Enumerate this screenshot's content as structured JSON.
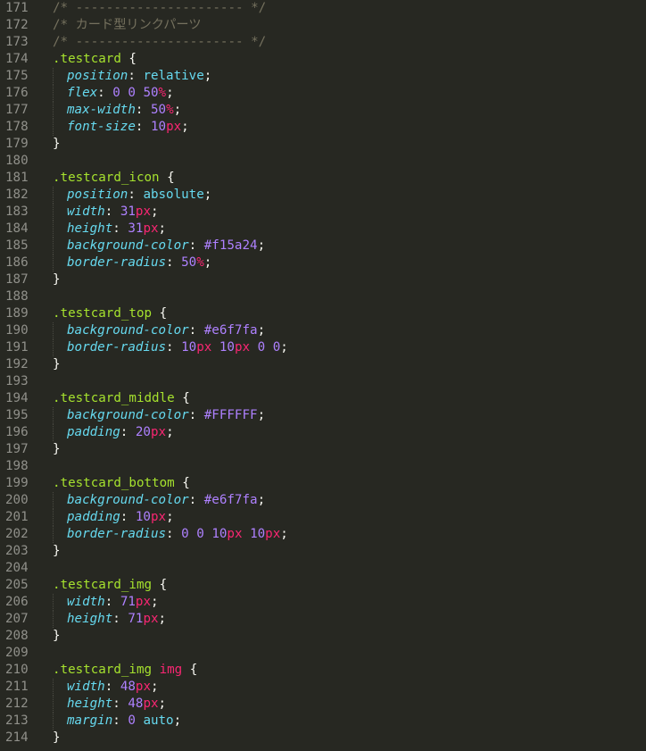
{
  "colors": {
    "background": "#272822",
    "line_number": "#90908a",
    "comment": "#75715e",
    "selector": "#a6e22e",
    "tag": "#f92672",
    "property": "#66d9ef",
    "value_keyword": "#66d9ef",
    "number": "#ae81ff",
    "unit": "#f92672",
    "punctuation": "#f8f8f2"
  },
  "lines": [
    {
      "n": "171",
      "tokens": [
        [
          "comment",
          "/* ---------------------- */"
        ]
      ]
    },
    {
      "n": "172",
      "tokens": [
        [
          "comment",
          "/* カード型リンクパーツ"
        ]
      ]
    },
    {
      "n": "173",
      "tokens": [
        [
          "comment",
          "/* ---------------------- */"
        ]
      ]
    },
    {
      "n": "174",
      "tokens": [
        [
          "sel",
          ".testcard"
        ],
        [
          "punct",
          " {"
        ]
      ]
    },
    {
      "n": "175",
      "indent": true,
      "tokens": [
        [
          "prop",
          "position"
        ],
        [
          "punct",
          ": "
        ],
        [
          "val",
          "relative"
        ],
        [
          "punct",
          ";"
        ]
      ]
    },
    {
      "n": "176",
      "indent": true,
      "tokens": [
        [
          "prop",
          "flex"
        ],
        [
          "punct",
          ": "
        ],
        [
          "num",
          "0"
        ],
        [
          "punct",
          " "
        ],
        [
          "num",
          "0"
        ],
        [
          "punct",
          " "
        ],
        [
          "num",
          "50"
        ],
        [
          "unit",
          "%"
        ],
        [
          "punct",
          ";"
        ]
      ]
    },
    {
      "n": "177",
      "indent": true,
      "tokens": [
        [
          "prop",
          "max-width"
        ],
        [
          "punct",
          ": "
        ],
        [
          "num",
          "50"
        ],
        [
          "unit",
          "%"
        ],
        [
          "punct",
          ";"
        ]
      ]
    },
    {
      "n": "178",
      "indent": true,
      "tokens": [
        [
          "prop",
          "font-size"
        ],
        [
          "punct",
          ": "
        ],
        [
          "num",
          "10"
        ],
        [
          "unit",
          "px"
        ],
        [
          "punct",
          ";"
        ]
      ]
    },
    {
      "n": "179",
      "tokens": [
        [
          "punct",
          "}"
        ]
      ]
    },
    {
      "n": "180",
      "tokens": []
    },
    {
      "n": "181",
      "tokens": [
        [
          "sel",
          ".testcard_icon"
        ],
        [
          "punct",
          " {"
        ]
      ]
    },
    {
      "n": "182",
      "indent": true,
      "tokens": [
        [
          "prop",
          "position"
        ],
        [
          "punct",
          ": "
        ],
        [
          "val",
          "absolute"
        ],
        [
          "punct",
          ";"
        ]
      ]
    },
    {
      "n": "183",
      "indent": true,
      "tokens": [
        [
          "prop",
          "width"
        ],
        [
          "punct",
          ": "
        ],
        [
          "num",
          "31"
        ],
        [
          "unit",
          "px"
        ],
        [
          "punct",
          ";"
        ]
      ]
    },
    {
      "n": "184",
      "indent": true,
      "tokens": [
        [
          "prop",
          "height"
        ],
        [
          "punct",
          ": "
        ],
        [
          "num",
          "31"
        ],
        [
          "unit",
          "px"
        ],
        [
          "punct",
          ";"
        ]
      ]
    },
    {
      "n": "185",
      "indent": true,
      "tokens": [
        [
          "prop",
          "background-color"
        ],
        [
          "punct",
          ": "
        ],
        [
          "num",
          "#f15a24"
        ],
        [
          "punct",
          ";"
        ]
      ]
    },
    {
      "n": "186",
      "indent": true,
      "tokens": [
        [
          "prop",
          "border-radius"
        ],
        [
          "punct",
          ": "
        ],
        [
          "num",
          "50"
        ],
        [
          "unit",
          "%"
        ],
        [
          "punct",
          ";"
        ]
      ]
    },
    {
      "n": "187",
      "tokens": [
        [
          "punct",
          "}"
        ]
      ]
    },
    {
      "n": "188",
      "tokens": []
    },
    {
      "n": "189",
      "tokens": [
        [
          "sel",
          ".testcard_top"
        ],
        [
          "punct",
          " {"
        ]
      ]
    },
    {
      "n": "190",
      "indent": true,
      "tokens": [
        [
          "prop",
          "background-color"
        ],
        [
          "punct",
          ": "
        ],
        [
          "num",
          "#e6f7fa"
        ],
        [
          "punct",
          ";"
        ]
      ]
    },
    {
      "n": "191",
      "indent": true,
      "tokens": [
        [
          "prop",
          "border-radius"
        ],
        [
          "punct",
          ": "
        ],
        [
          "num",
          "10"
        ],
        [
          "unit",
          "px"
        ],
        [
          "punct",
          " "
        ],
        [
          "num",
          "10"
        ],
        [
          "unit",
          "px"
        ],
        [
          "punct",
          " "
        ],
        [
          "num",
          "0"
        ],
        [
          "punct",
          " "
        ],
        [
          "num",
          "0"
        ],
        [
          "punct",
          ";"
        ]
      ]
    },
    {
      "n": "192",
      "tokens": [
        [
          "punct",
          "}"
        ]
      ]
    },
    {
      "n": "193",
      "tokens": []
    },
    {
      "n": "194",
      "tokens": [
        [
          "sel",
          ".testcard_middle"
        ],
        [
          "punct",
          " {"
        ]
      ]
    },
    {
      "n": "195",
      "indent": true,
      "tokens": [
        [
          "prop",
          "background-color"
        ],
        [
          "punct",
          ": "
        ],
        [
          "num",
          "#FFFFFF"
        ],
        [
          "punct",
          ";"
        ]
      ]
    },
    {
      "n": "196",
      "indent": true,
      "tokens": [
        [
          "prop",
          "padding"
        ],
        [
          "punct",
          ": "
        ],
        [
          "num",
          "20"
        ],
        [
          "unit",
          "px"
        ],
        [
          "punct",
          ";"
        ]
      ]
    },
    {
      "n": "197",
      "tokens": [
        [
          "punct",
          "}"
        ]
      ]
    },
    {
      "n": "198",
      "tokens": []
    },
    {
      "n": "199",
      "tokens": [
        [
          "sel",
          ".testcard_bottom"
        ],
        [
          "punct",
          " {"
        ]
      ]
    },
    {
      "n": "200",
      "indent": true,
      "tokens": [
        [
          "prop",
          "background-color"
        ],
        [
          "punct",
          ": "
        ],
        [
          "num",
          "#e6f7fa"
        ],
        [
          "punct",
          ";"
        ]
      ]
    },
    {
      "n": "201",
      "indent": true,
      "tokens": [
        [
          "prop",
          "padding"
        ],
        [
          "punct",
          ": "
        ],
        [
          "num",
          "10"
        ],
        [
          "unit",
          "px"
        ],
        [
          "punct",
          ";"
        ]
      ]
    },
    {
      "n": "202",
      "indent": true,
      "tokens": [
        [
          "prop",
          "border-radius"
        ],
        [
          "punct",
          ": "
        ],
        [
          "num",
          "0"
        ],
        [
          "punct",
          " "
        ],
        [
          "num",
          "0"
        ],
        [
          "punct",
          " "
        ],
        [
          "num",
          "10"
        ],
        [
          "unit",
          "px"
        ],
        [
          "punct",
          " "
        ],
        [
          "num",
          "10"
        ],
        [
          "unit",
          "px"
        ],
        [
          "punct",
          ";"
        ]
      ]
    },
    {
      "n": "203",
      "tokens": [
        [
          "punct",
          "}"
        ]
      ]
    },
    {
      "n": "204",
      "tokens": []
    },
    {
      "n": "205",
      "tokens": [
        [
          "sel",
          ".testcard_img"
        ],
        [
          "punct",
          " {"
        ]
      ]
    },
    {
      "n": "206",
      "indent": true,
      "tokens": [
        [
          "prop",
          "width"
        ],
        [
          "punct",
          ": "
        ],
        [
          "num",
          "71"
        ],
        [
          "unit",
          "px"
        ],
        [
          "punct",
          ";"
        ]
      ]
    },
    {
      "n": "207",
      "indent": true,
      "tokens": [
        [
          "prop",
          "height"
        ],
        [
          "punct",
          ": "
        ],
        [
          "num",
          "71"
        ],
        [
          "unit",
          "px"
        ],
        [
          "punct",
          ";"
        ]
      ]
    },
    {
      "n": "208",
      "tokens": [
        [
          "punct",
          "}"
        ]
      ]
    },
    {
      "n": "209",
      "tokens": []
    },
    {
      "n": "210",
      "tokens": [
        [
          "sel",
          ".testcard_img"
        ],
        [
          "punct",
          " "
        ],
        [
          "tag",
          "img"
        ],
        [
          "punct",
          " {"
        ]
      ]
    },
    {
      "n": "211",
      "indent": true,
      "tokens": [
        [
          "prop",
          "width"
        ],
        [
          "punct",
          ": "
        ],
        [
          "num",
          "48"
        ],
        [
          "unit",
          "px"
        ],
        [
          "punct",
          ";"
        ]
      ]
    },
    {
      "n": "212",
      "indent": true,
      "tokens": [
        [
          "prop",
          "height"
        ],
        [
          "punct",
          ": "
        ],
        [
          "num",
          "48"
        ],
        [
          "unit",
          "px"
        ],
        [
          "punct",
          ";"
        ]
      ]
    },
    {
      "n": "213",
      "indent": true,
      "tokens": [
        [
          "prop",
          "margin"
        ],
        [
          "punct",
          ": "
        ],
        [
          "num",
          "0"
        ],
        [
          "punct",
          " "
        ],
        [
          "val",
          "auto"
        ],
        [
          "punct",
          ";"
        ]
      ]
    },
    {
      "n": "214",
      "tokens": [
        [
          "punct",
          "}"
        ]
      ]
    }
  ]
}
